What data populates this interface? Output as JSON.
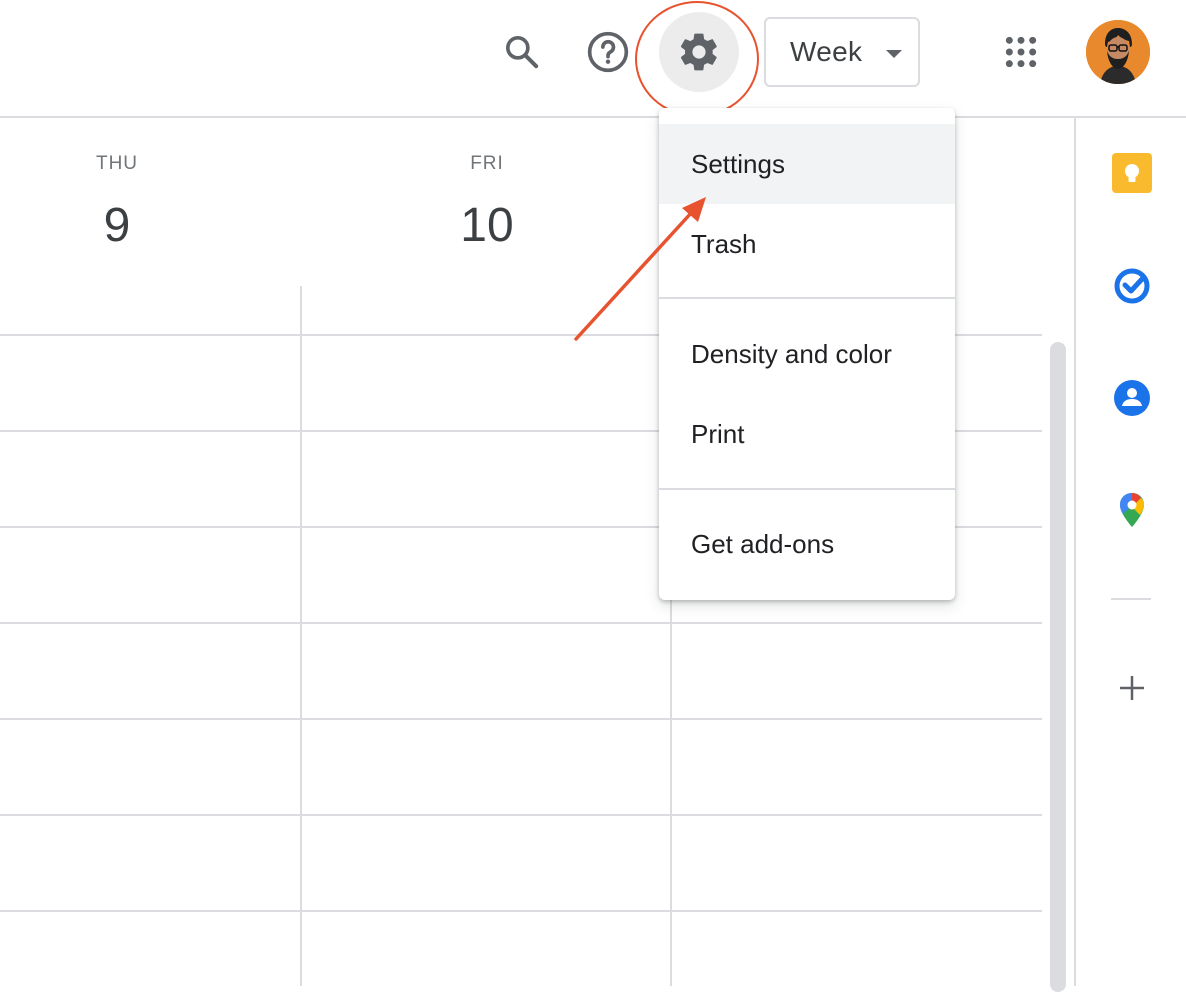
{
  "header": {
    "view_select": {
      "label": "Week"
    }
  },
  "days": [
    {
      "dow": "THU",
      "num": "9"
    },
    {
      "dow": "FRI",
      "num": "10"
    }
  ],
  "settings_menu": {
    "items": [
      "Settings",
      "Trash",
      "Density and color",
      "Print",
      "Get add-ons"
    ],
    "highlighted": "Settings"
  },
  "side_panel": {
    "apps": [
      "keep-icon",
      "tasks-icon",
      "contacts-icon",
      "maps-icon"
    ],
    "add_label": "+"
  },
  "colors": {
    "annotation": "#e8532f",
    "keep": "#f9bb2d",
    "tasks": "#1a73e8",
    "contacts": "#1a73e8"
  }
}
